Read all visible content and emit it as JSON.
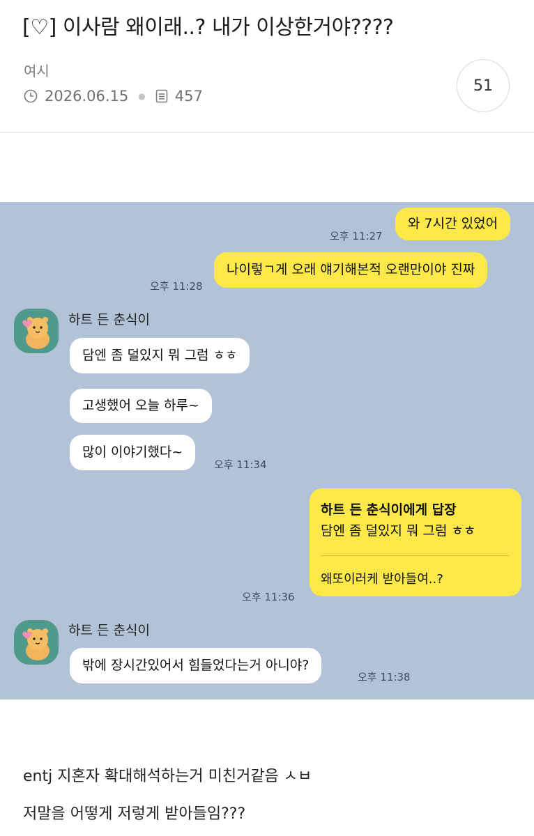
{
  "post": {
    "title": "[♡] 이사람 왜이래..? 내가 이상한거야????",
    "author": "여시",
    "date": "2026.06.15",
    "views": "457",
    "comment_count": "51"
  },
  "chat": {
    "messages": [
      {
        "text": "와 7시간 있었어",
        "time": "오후 11:27"
      },
      {
        "text": "나이렇ㄱ게 오래 얘기해본적 오랜만이야 진짜",
        "time": "오후 11:28"
      },
      {
        "sender": "하트 든 춘식이"
      },
      {
        "text": "담엔 좀 덜있지 뭐 그럼 ㅎㅎ"
      },
      {
        "text": "고생했어 오늘 하루~"
      },
      {
        "text": "많이 이야기했다~",
        "time": "오후 11:34"
      },
      {
        "reply_title": "하트 든 춘식이에게 답장",
        "reply_quote": "담엔 좀 덜있지 뭐 그럼 ㅎㅎ",
        "text": "왜또이러케 받아들여..?",
        "time": "오후 11:36"
      },
      {
        "sender": "하트 든 춘식이"
      },
      {
        "text": "밖에 장시간있어서 힘들었다는거 아니야?",
        "time": "오후 11:38"
      }
    ]
  },
  "comment": {
    "line1": "entj 지혼자 확대해석하는거 미친거같음 ㅅㅂ",
    "line2": "저말을 어떻게 저렇게 받아들임???"
  },
  "colors": {
    "chat_bg": "#b2c3d8",
    "my_bubble": "#fde84a",
    "their_bubble": "#ffffff",
    "avatar_bg": "#4f9a8c"
  }
}
